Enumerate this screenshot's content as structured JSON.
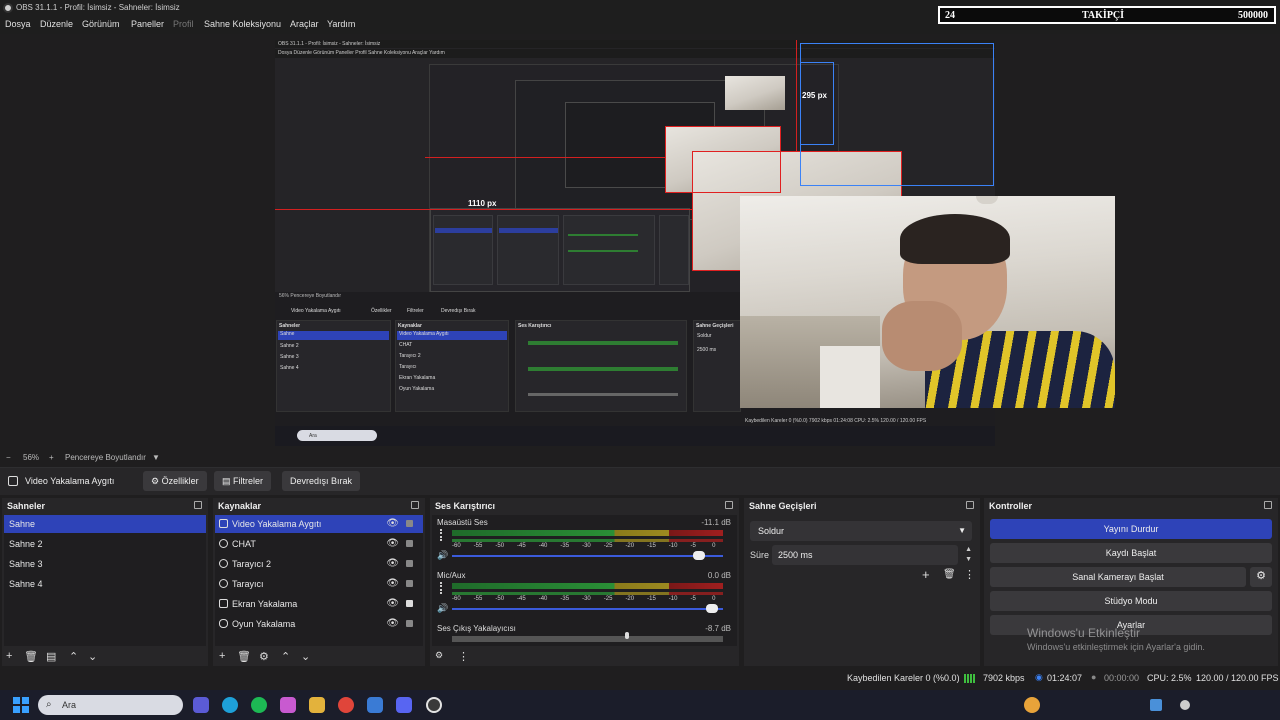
{
  "window": {
    "title": "OBS 31.1.1 - Profil: İsimsiz - Sahneler: İsimsiz"
  },
  "menu": [
    "Dosya",
    "Düzenle",
    "Görünüm",
    "Paneller",
    "Profil",
    "Sahne Koleksiyonu",
    "Araçlar",
    "Yardım"
  ],
  "follower_overlay": {
    "count_left": "24",
    "label": "TAKİPÇİ",
    "goal": "500000"
  },
  "preview": {
    "nested_title": "OBS 31.1.1 - Profil: İsimsiz - Sahneler: İsimsiz",
    "nested_menu": "Dosya   Düzenle   Görünüm   Paneller   Profil   Sahne Koleksiyonu   Araçlar   Yardım",
    "label_1110": "1110 px",
    "label_295": "295 px",
    "mini_zoom": "56%   Pencereye Boyutlandır",
    "mini_source": "Video Yakalama Aygıtı",
    "mini_props": "Özellikler",
    "mini_filters": "Filtreler",
    "mini_deact": "Devredışı Bırak",
    "mini_scenes_title": "Sahneler",
    "mini_scenes": [
      "Sahne",
      "Sahne 2",
      "Sahne 3",
      "Sahne 4"
    ],
    "mini_sources_title": "Kaynaklar",
    "mini_sources": [
      "Video Yakalama Aygıtı",
      "CHAT",
      "Tarayıcı 2",
      "Tarayıcı",
      "Ekran Yakalama",
      "Oyun Yakalama"
    ],
    "mini_mixer_title": "Ses Karıştırıcı",
    "mini_trans_title": "Sahne Geçişleri",
    "mini_trans_value": "Soldur",
    "mini_duration": "2500 ms",
    "mini_status": "Kaybedilen Kareler 0 (%0.0)   7902 kbps   01:24:08   CPU: 2.5%   120.00 / 120.00 FPS",
    "mini_search": "Ara"
  },
  "zoom": {
    "minus": "−",
    "level": "56%",
    "plus": "+",
    "fit": "Pencereye Boyutlandır"
  },
  "source_toolbar": {
    "source": "Video Yakalama Aygıtı",
    "properties": "Özellikler",
    "filters": "Filtreler",
    "deactivate": "Devredışı Bırak"
  },
  "scenes": {
    "title": "Sahneler",
    "items": [
      "Sahne",
      "Sahne 2",
      "Sahne 3",
      "Sahne 4"
    ],
    "selected": 0
  },
  "sources": {
    "title": "Kaynaklar",
    "items": [
      {
        "name": "Video Yakalama Aygıtı",
        "icon": "camera-icon"
      },
      {
        "name": "CHAT",
        "icon": "globe-icon"
      },
      {
        "name": "Tarayıcı 2",
        "icon": "globe-icon"
      },
      {
        "name": "Tarayıcı",
        "icon": "globe-icon"
      },
      {
        "name": "Ekran Yakalama",
        "icon": "monitor-icon"
      },
      {
        "name": "Oyun Yakalama",
        "icon": "gamepad-icon"
      }
    ],
    "selected": 0
  },
  "mixer": {
    "title": "Ses Karıştırıcı",
    "ticks": [
      "-60",
      "-55",
      "-50",
      "-45",
      "-40",
      "-35",
      "-30",
      "-25",
      "-20",
      "-15",
      "-10",
      "-5",
      "0"
    ],
    "channels": [
      {
        "name": "Masaüstü Ses",
        "db": "-11.1 dB",
        "volume": 0.92
      },
      {
        "name": "Mic/Aux",
        "db": "0.0 dB",
        "volume": 0.97
      },
      {
        "name": "Ses Çıkış Yakalayıcısı",
        "db": "-8.7 dB",
        "volume": 0.72
      }
    ]
  },
  "transitions": {
    "title": "Sahne Geçişleri",
    "value": "Soldur",
    "duration_label": "Süre",
    "duration": "2500 ms"
  },
  "controls": {
    "title": "Kontroller",
    "stop_stream": "Yayını Durdur",
    "start_record": "Kaydı Başlat",
    "virtual_cam": "Sanal Kamerayı Başlat",
    "studio_mode": "Stüdyo Modu",
    "settings": "Ayarlar"
  },
  "activation": {
    "line1": "Windows'u Etkinleştir",
    "line2": "Windows'u etkinleştirmek için Ayarlar'a gidin."
  },
  "status": {
    "dropped": "Kaybedilen Kareler 0 (%0.0)",
    "bitrate": "7902 kbps",
    "stream_time": "01:24:07",
    "record_time": "00:00:00",
    "cpu": "CPU: 2.5%",
    "fps": "120.00 / 120.00 FPS"
  },
  "taskbar": {
    "search": "Ara"
  },
  "colors": {
    "accent": "#2e43b8",
    "panel": "#272628",
    "bg": "#1f1e1f",
    "measure": "#e02020"
  }
}
